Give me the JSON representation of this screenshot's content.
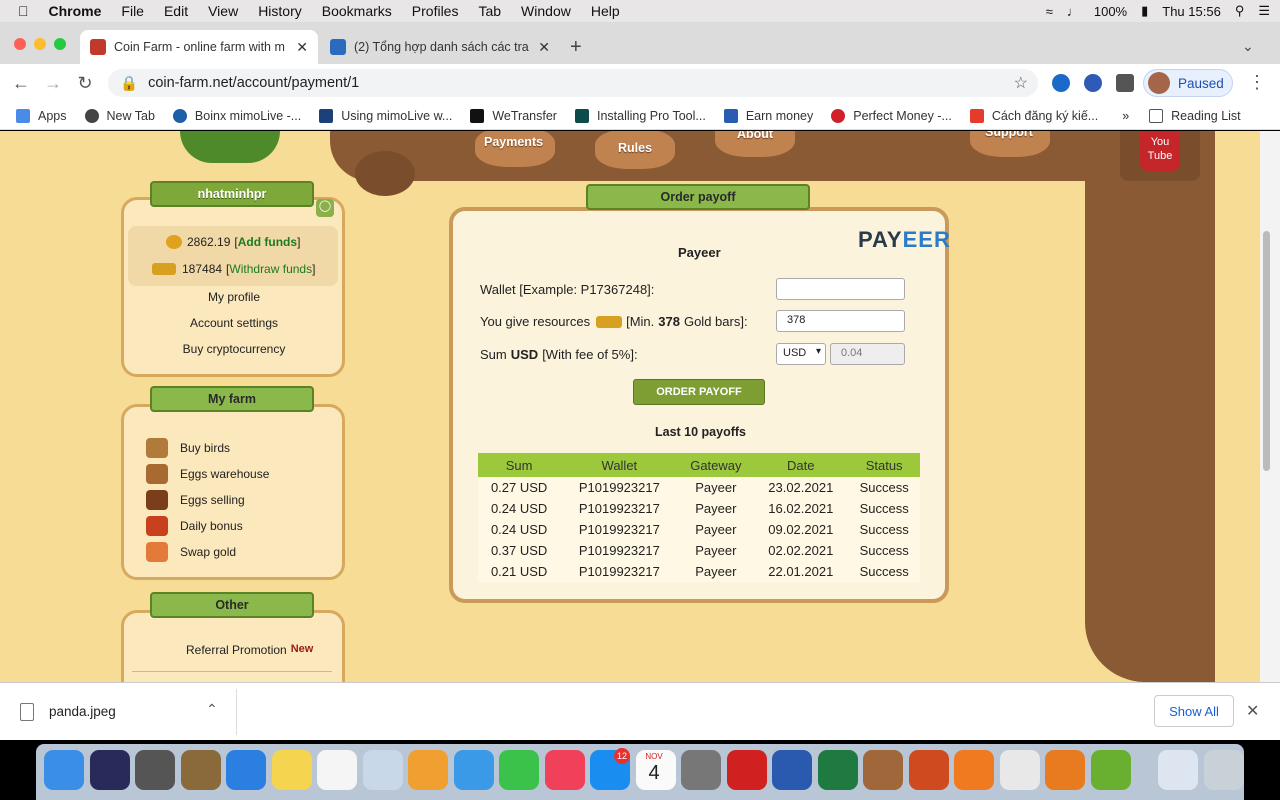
{
  "menubar": {
    "app": "Chrome",
    "items": [
      "File",
      "Edit",
      "View",
      "History",
      "Bookmarks",
      "Profiles",
      "Tab",
      "Window",
      "Help"
    ],
    "battery": "100%",
    "clock": "Thu 15:56"
  },
  "tabs": [
    {
      "title": "Coin Farm - online farm with m"
    },
    {
      "title": "(2) Tổng hợp danh sách các tra"
    }
  ],
  "toolbar": {
    "url": "coin-farm.net/account/payment/1",
    "profile_status": "Paused"
  },
  "bookmarks": [
    "Apps",
    "New Tab",
    "Boinx mimoLive -...",
    "Using mimoLive w...",
    "WeTransfer",
    "Installing Pro Tool...",
    "Earn money",
    "Perfect Money -...",
    "Cách đăng ký kiế..."
  ],
  "reading_list": "Reading List",
  "site": {
    "topnav": [
      "Payments",
      "Rules",
      "About",
      "Support"
    ],
    "youtube": "You Tube",
    "user": {
      "name": "nhatminhpr",
      "balance": "2862.19",
      "add_funds": "Add funds",
      "gold": "187484",
      "withdraw": "Withdraw funds",
      "links": [
        "My profile",
        "Account settings",
        "Buy cryptocurrency"
      ]
    },
    "farm": {
      "title": "My farm",
      "items": [
        "Buy birds",
        "Eggs warehouse",
        "Eggs selling",
        "Daily bonus",
        "Swap gold"
      ]
    },
    "other": {
      "title": "Other",
      "referral": "Referral Promotion",
      "new_badge": "New"
    },
    "order": {
      "title": "Order payoff",
      "gateway": "Payeer",
      "logo_a": "PAY",
      "logo_b": "EER",
      "wallet_label": "Wallet [Example: P17367248]:",
      "wallet_value": "",
      "give_label_a": "You give resources",
      "give_label_b": "[Min.",
      "give_min": "378",
      "give_label_c": "Gold bars]:",
      "give_value": "378",
      "sum_label_a": "Sum",
      "sum_currency": "USD",
      "sum_label_b": "[With fee of 5%]:",
      "currency_select": "USD",
      "sum_value": "0.04",
      "button": "ORDER PAYOFF",
      "last_title": "Last 10 payoffs"
    },
    "payoffs": {
      "headers": [
        "Sum",
        "Wallet",
        "Gateway",
        "Date",
        "Status"
      ],
      "rows": [
        [
          "0.27 USD",
          "P1019923217",
          "Payeer",
          "23.02.2021",
          "Success"
        ],
        [
          "0.24 USD",
          "P1019923217",
          "Payeer",
          "16.02.2021",
          "Success"
        ],
        [
          "0.24 USD",
          "P1019923217",
          "Payeer",
          "09.02.2021",
          "Success"
        ],
        [
          "0.37 USD",
          "P1019923217",
          "Payeer",
          "02.02.2021",
          "Success"
        ],
        [
          "0.21 USD",
          "P1019923217",
          "Payeer",
          "22.01.2021",
          "Success"
        ]
      ]
    }
  },
  "download": {
    "file": "panda.jpeg",
    "show_all": "Show All"
  },
  "dock_apps": [
    "finder-icon",
    "siri-icon",
    "launchpad-icon",
    "preview-icon",
    "safari-icon",
    "notes-icon",
    "reminders-icon",
    "photo-booth-icon",
    "photos-icon",
    "messages-icon",
    "facetime-icon",
    "music-icon",
    "app-store-icon",
    "calendar-icon",
    "system-preferences-icon",
    "acrobat-icon",
    "word-icon",
    "excel-icon",
    "contacts-icon",
    "powerpoint-icon",
    "books-icon",
    "chrome-icon",
    "ccleaner-icon",
    "upwork-icon",
    "chrome-app-icon",
    "trash-icon"
  ],
  "dock_badges": {
    "app_store": "12",
    "calendar_month": "NOV",
    "calendar_day": "4"
  }
}
